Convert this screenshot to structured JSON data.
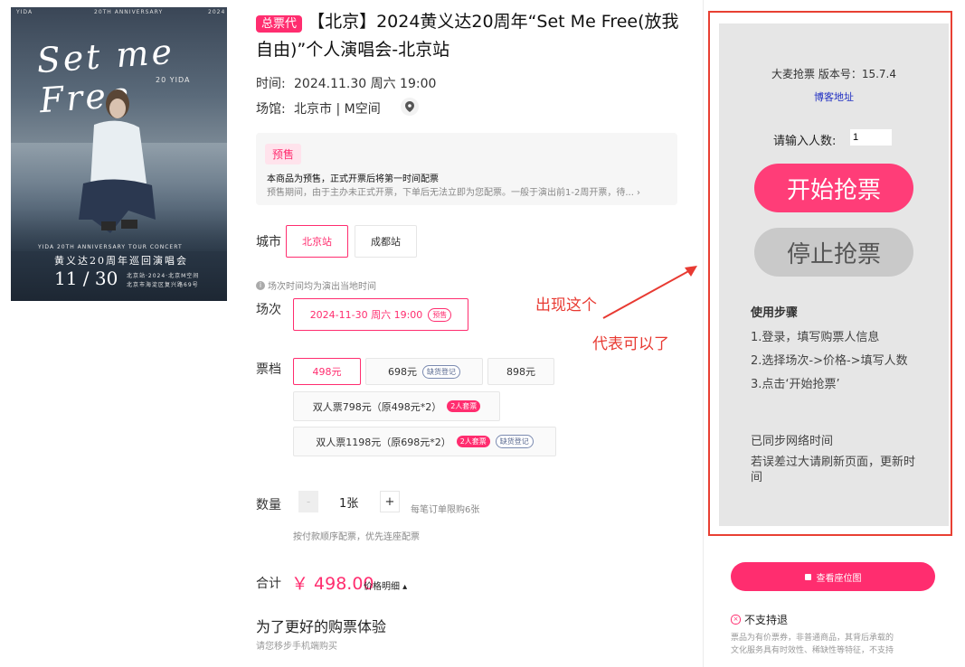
{
  "poster": {
    "script_title": "Set me Free",
    "header_left": "YIDA",
    "header_mid": "20TH ANNIVERSARY",
    "header_right": "2024",
    "badge": "20 YIDA",
    "tour_en": "YIDA 20TH ANNIVERSARY TOUR CONCERT",
    "tour_cn": "黄义达20周年巡回演唱会",
    "date": "11 / 30",
    "venue_lines": [
      "北京站·2024·北京M空间",
      "北京市海淀区复兴路69号"
    ]
  },
  "event": {
    "tag": "总票代",
    "title": "【北京】2024黄义达20周年“Set Me Free(放我自由)”个人演唱会-北京站",
    "time_label": "时间:",
    "time_value": "2024.11.30 周六 19:00",
    "venue_label": "场馆:",
    "venue_value": "北京市 | M空间"
  },
  "presale": {
    "tag": "预售",
    "main": "本商品为预售，正式开票后将第一时间配票",
    "sub": "预售期间，由于主办未正式开票，下单后无法立即为您配票。一般于演出前1-2周开票，待... ›"
  },
  "city": {
    "label": "城市",
    "options": [
      "北京站",
      "成都站"
    ]
  },
  "session": {
    "note": "场次时间均为演出当地时间",
    "label": "场次",
    "option": "2024-11-30 周六 19:00",
    "option_pill": "预售"
  },
  "tickets": {
    "label": "票档",
    "options": [
      {
        "text": "498元",
        "pill": ""
      },
      {
        "text": "698元",
        "pill": "缺货登记"
      },
      {
        "text": "898元",
        "pill": ""
      },
      {
        "text": "双人票798元（原498元*2）",
        "pill": "2人套票"
      },
      {
        "text": "双人票1198元（原698元*2）",
        "pill": "2人套票",
        "pill2": "缺货登记"
      }
    ]
  },
  "quantity": {
    "label": "数量",
    "minus": "-",
    "value": "1张",
    "plus": "+",
    "limit": "每笔订单限购6张",
    "note": "按付款顺序配票，优先连座配票"
  },
  "total": {
    "label": "合计",
    "price": "￥ 498.00",
    "detail": "价格明细 ▴"
  },
  "mobile": {
    "heading": "为了更好的购票体验",
    "sub": "请您移步手机端购买"
  },
  "annotation": {
    "line1": "出现这个",
    "line2": "代表可以了"
  },
  "tool": {
    "version": "大麦抢票 版本号：15.7.4",
    "blog_link": "博客地址",
    "count_label": "请输入人数:",
    "count_value": "1",
    "start_button": "开始抢票",
    "stop_button": "停止抢票",
    "steps_title": "使用步骤",
    "steps": [
      "1.登录，填写购票人信息",
      "2.选择场次->价格->填写人数",
      "3.点击‘开始抢票’"
    ],
    "sync_status": "已同步网络时间",
    "sync_hint": "若误差过大请刷新页面，更新时间"
  },
  "side": {
    "seat_button": "查看座位图",
    "no_refund": "不支持退",
    "refund_text_1": "票品为有价票券，非普通商品，其背后承载的",
    "refund_text_2": "文化服务具有时效性、稀缺性等特征，不支持"
  },
  "colors": {
    "brand": "#ff2d6f",
    "annotation": "#e83a32",
    "panel": "#e6e6e6",
    "link": "#1f2ec2"
  }
}
